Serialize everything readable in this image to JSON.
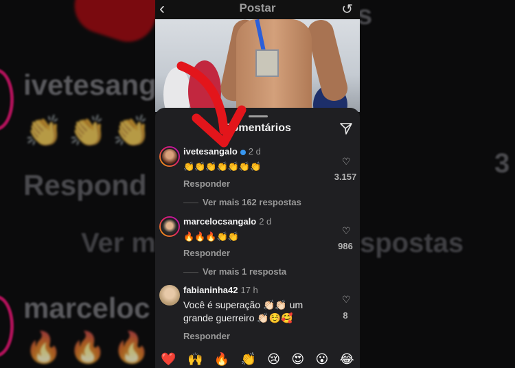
{
  "header": {
    "title": "Postar"
  },
  "sheet": {
    "title": "Comentários"
  },
  "comments": [
    {
      "username": "ivetesangalo",
      "time": "2 d",
      "text": "👏👏👏👏👏👏👏",
      "reply_label": "Responder",
      "likes": "3.157",
      "more_replies": "Ver mais 162 respostas"
    },
    {
      "username": "marcelocsangalo",
      "time": "2 d",
      "text": "🔥🔥🔥👏👏",
      "reply_label": "Responder",
      "likes": "986",
      "more_replies": "Ver mais 1 resposta"
    },
    {
      "username": "fabianinha42",
      "time": "17 h",
      "text": "Você é superação 👏🏻👏🏻 um grande guerreiro 👏🏻☺️🥰",
      "reply_label": "Responder",
      "likes": "8"
    }
  ],
  "emoji_bar": [
    "❤️",
    "🙌",
    "🔥",
    "👏",
    "😢",
    "😍",
    "😮",
    "😂"
  ],
  "background": {
    "left_texts": [
      "ivetesang",
      "Respond",
      "marceloc"
    ],
    "right_text": "3",
    "center_text": "Ver mais 162 respostas"
  },
  "colors": {
    "verified": "#3897f0",
    "arrow": "#e3151b",
    "sheet": "#1f1f22"
  },
  "icons": [
    "back-icon",
    "reload-icon",
    "send-icon",
    "heart-icon",
    "verified-icon"
  ]
}
